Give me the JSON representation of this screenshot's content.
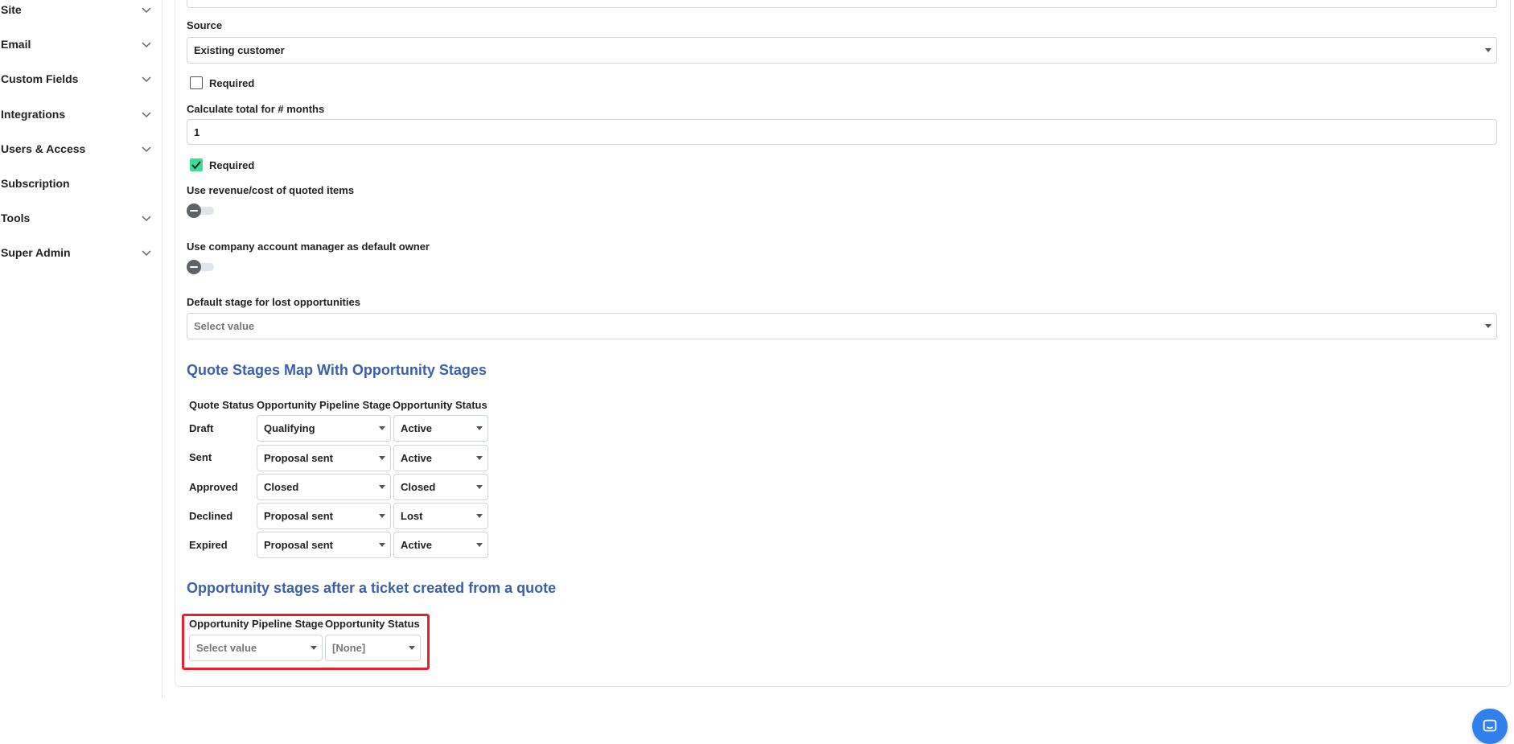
{
  "sidebar": {
    "items": [
      {
        "label": "Site",
        "has_chevron": true
      },
      {
        "label": "Email",
        "has_chevron": true
      },
      {
        "label": "Custom Fields",
        "has_chevron": true
      },
      {
        "label": "Integrations",
        "has_chevron": true
      },
      {
        "label": "Users & Access",
        "has_chevron": true
      },
      {
        "label": "Subscription",
        "has_chevron": false
      },
      {
        "label": "Tools",
        "has_chevron": true
      },
      {
        "label": "Super Admin",
        "has_chevron": true
      }
    ]
  },
  "form": {
    "source": {
      "label": "Source",
      "value": "Existing customer"
    },
    "source_required": {
      "label": "Required",
      "checked": false
    },
    "months": {
      "label": "Calculate total for # months",
      "value": "1"
    },
    "months_required": {
      "label": "Required",
      "checked": true
    },
    "use_revenue": {
      "label": "Use revenue/cost of quoted items",
      "on": false
    },
    "use_account_manager": {
      "label": "Use company account manager as default owner",
      "on": false
    },
    "default_lost_stage": {
      "label": "Default stage for lost opportunities",
      "placeholder": "Select value"
    }
  },
  "quote_map": {
    "title": "Quote Stages Map With Opportunity Stages",
    "headers": [
      "Quote Status",
      "Opportunity Pipeline Stage",
      "Opportunity Status"
    ],
    "rows": [
      {
        "status": "Draft",
        "stage": "Qualifying",
        "opp_status": "Active"
      },
      {
        "status": "Sent",
        "stage": "Proposal sent",
        "opp_status": "Active"
      },
      {
        "status": "Approved",
        "stage": "Closed",
        "opp_status": "Closed"
      },
      {
        "status": "Declined",
        "stage": "Proposal sent",
        "opp_status": "Lost"
      },
      {
        "status": "Expired",
        "stage": "Proposal sent",
        "opp_status": "Active"
      }
    ]
  },
  "ticket_stages": {
    "title": "Opportunity stages after a ticket created from a quote",
    "headers": [
      "Opportunity Pipeline Stage",
      "Opportunity Status"
    ],
    "stage_placeholder": "Select value",
    "status_value": "[None]"
  },
  "colors": {
    "accent_title": "#3b5fae",
    "checkbox_checked": "#3ddc97",
    "highlight": "#e3232c",
    "chat_button": "#2f80ed"
  },
  "icons": {
    "chevron": "chevron-down-icon",
    "check": "check-icon",
    "chat": "chat-icon"
  }
}
